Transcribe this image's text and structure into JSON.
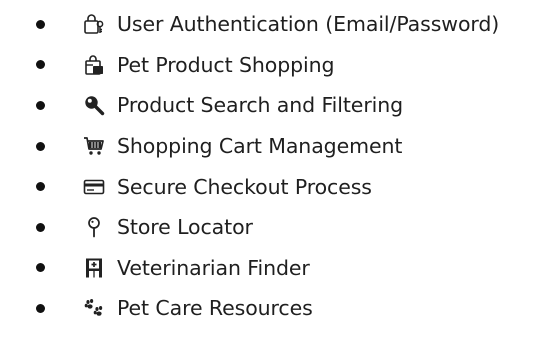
{
  "features": [
    {
      "icon": "locked-with-key-icon",
      "label": "User Authentication (Email/Password)"
    },
    {
      "icon": "shopping-bags-icon",
      "label": "Pet Product Shopping"
    },
    {
      "icon": "magnifying-glass-icon",
      "label": "Product Search and Filtering"
    },
    {
      "icon": "shopping-cart-icon",
      "label": "Shopping Cart Management"
    },
    {
      "icon": "credit-card-icon",
      "label": "Secure Checkout Process"
    },
    {
      "icon": "map-pin-icon",
      "label": "Store Locator"
    },
    {
      "icon": "hospital-icon",
      "label": "Veterinarian Finder"
    },
    {
      "icon": "paw-prints-icon",
      "label": "Pet Care Resources"
    }
  ]
}
